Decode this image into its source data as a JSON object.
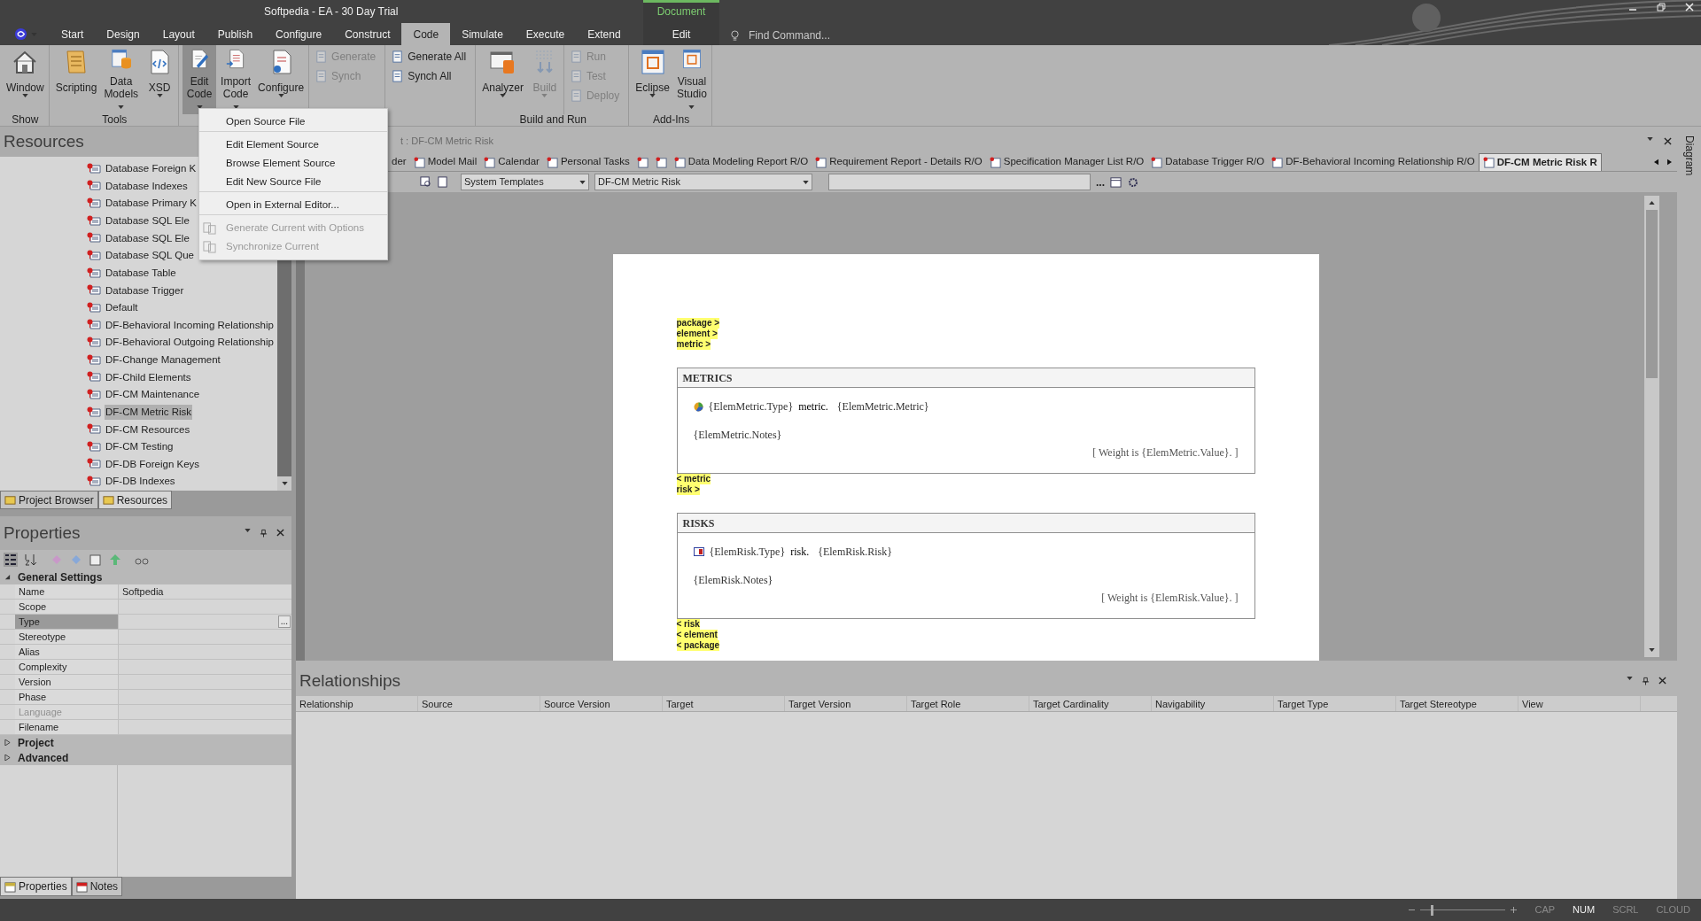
{
  "window": {
    "title": "Softpedia - EA - 30 Day Trial"
  },
  "ribbon_tabs": [
    {
      "label": "Start",
      "selected": false
    },
    {
      "label": "Design",
      "selected": false
    },
    {
      "label": "Layout",
      "selected": false
    },
    {
      "label": "Publish",
      "selected": false
    },
    {
      "label": "Configure",
      "selected": false
    },
    {
      "label": "Construct",
      "selected": false
    },
    {
      "label": "Code",
      "selected": true
    },
    {
      "label": "Simulate",
      "selected": false
    },
    {
      "label": "Execute",
      "selected": false
    },
    {
      "label": "Extend",
      "selected": false
    }
  ],
  "contextual_tab": {
    "group": "Document",
    "label": "Edit"
  },
  "find_command": {
    "placeholder": "Find Command..."
  },
  "ribbon_groups": [
    {
      "label": "Show",
      "items": [
        {
          "kind": "large",
          "label": "Window",
          "dropdown": true,
          "pressed": false,
          "disabled": false
        }
      ]
    },
    {
      "label": "Tools",
      "items": [
        {
          "kind": "large",
          "label": "Scripting",
          "dropdown": false,
          "pressed": false,
          "disabled": false
        },
        {
          "kind": "large",
          "label": "Data Models",
          "dropdown": true,
          "pressed": false,
          "disabled": false
        },
        {
          "kind": "large",
          "label": "XSD",
          "dropdown": true,
          "pressed": false,
          "disabled": false
        }
      ]
    },
    {
      "items": [
        {
          "kind": "large",
          "label": "Edit Code",
          "dropdown": true,
          "pressed": true,
          "disabled": false
        },
        {
          "kind": "large",
          "label": "Import Code",
          "dropdown": true,
          "pressed": false,
          "disabled": false
        },
        {
          "kind": "large",
          "label": "Configure",
          "dropdown": true,
          "pressed": false,
          "disabled": false
        },
        {
          "kind": "stack",
          "items": [
            {
              "label": "Generate",
              "disabled": true
            },
            {
              "label": "Synch",
              "disabled": true
            }
          ]
        },
        {
          "kind": "stack",
          "items": [
            {
              "label": "Generate All",
              "disabled": false
            },
            {
              "label": "Synch All",
              "disabled": false
            }
          ]
        }
      ]
    },
    {
      "label": "Build and Run",
      "items": [
        {
          "kind": "large",
          "label": "Analyzer",
          "dropdown": true,
          "pressed": false,
          "disabled": false
        },
        {
          "kind": "large",
          "label": "Build",
          "dropdown": true,
          "pressed": false,
          "disabled": true
        },
        {
          "kind": "stack",
          "items": [
            {
              "label": "Run",
              "disabled": true
            },
            {
              "label": "Test",
              "disabled": true
            },
            {
              "label": "Deploy",
              "disabled": true
            }
          ]
        }
      ]
    },
    {
      "label": "Add-Ins",
      "items": [
        {
          "kind": "large",
          "label": "Eclipse",
          "dropdown": true,
          "pressed": false,
          "disabled": false
        },
        {
          "kind": "large",
          "label": "Visual Studio",
          "dropdown": true,
          "pressed": false,
          "disabled": false
        }
      ]
    }
  ],
  "edit_code_menu": {
    "items": [
      {
        "label": "Open Source File",
        "disabled": false,
        "separator_after": true
      },
      {
        "label": "Edit Element Source",
        "disabled": false,
        "separator_after": false
      },
      {
        "label": "Browse Element Source",
        "disabled": false,
        "separator_after": false
      },
      {
        "label": "Edit New Source File",
        "disabled": false,
        "separator_after": true
      },
      {
        "label": "Open in External Editor...",
        "disabled": false,
        "separator_after": true
      },
      {
        "label": "Generate Current with Options",
        "disabled": true,
        "separator_after": false
      },
      {
        "label": "Synchronize Current",
        "disabled": true,
        "separator_after": false
      }
    ]
  },
  "resources": {
    "title": "Resources",
    "items": [
      {
        "label": "Database Foreign K",
        "selected": false
      },
      {
        "label": "Database Indexes",
        "selected": false
      },
      {
        "label": "Database Primary K",
        "selected": false
      },
      {
        "label": "Database SQL Ele",
        "selected": false
      },
      {
        "label": "Database SQL Ele",
        "selected": false
      },
      {
        "label": "Database SQL Que",
        "selected": false
      },
      {
        "label": "Database Table",
        "selected": false
      },
      {
        "label": "Database Trigger",
        "selected": false
      },
      {
        "label": "Default",
        "selected": false
      },
      {
        "label": "DF-Behavioral Incoming Relationship",
        "selected": false
      },
      {
        "label": "DF-Behavioral Outgoing Relationship",
        "selected": false
      },
      {
        "label": "DF-Change Management",
        "selected": false
      },
      {
        "label": "DF-Child Elements",
        "selected": false
      },
      {
        "label": "DF-CM Maintenance",
        "selected": false
      },
      {
        "label": "DF-CM Metric Risk",
        "selected": true
      },
      {
        "label": "DF-CM Resources",
        "selected": false
      },
      {
        "label": "DF-CM Testing",
        "selected": false
      },
      {
        "label": "DF-DB Foreign Keys",
        "selected": false
      },
      {
        "label": "DF-DB Indexes",
        "selected": false
      }
    ],
    "tabs": [
      {
        "label": "Project Browser",
        "selected": false
      },
      {
        "label": "Resources",
        "selected": true
      }
    ]
  },
  "properties": {
    "title": "Properties",
    "groups": [
      {
        "label": "General Settings",
        "expanded": true,
        "rows": [
          {
            "name": "Name",
            "value": "Softpedia",
            "selected": false,
            "disabled": false
          },
          {
            "name": "Scope",
            "selected": false,
            "disabled": false
          },
          {
            "name": "Type",
            "selected": true,
            "disabled": false
          },
          {
            "name": "Stereotype",
            "selected": false,
            "disabled": false
          },
          {
            "name": "Alias",
            "selected": false,
            "disabled": false
          },
          {
            "name": "Complexity",
            "selected": false,
            "disabled": false
          },
          {
            "name": "Version",
            "selected": false,
            "disabled": false
          },
          {
            "name": "Phase",
            "selected": false,
            "disabled": false
          },
          {
            "name": "Language",
            "selected": false,
            "disabled": true
          },
          {
            "name": "Filename",
            "selected": false,
            "disabled": false
          }
        ]
      },
      {
        "label": "Project",
        "expanded": false
      },
      {
        "label": "Advanced",
        "expanded": false
      }
    ],
    "ellipsis": "...",
    "tabs": [
      {
        "label": "Properties",
        "selected": true
      },
      {
        "label": "Notes",
        "selected": false
      }
    ]
  },
  "document": {
    "title": "t : DF-CM Metric Risk",
    "tabs": [
      {
        "label": "der",
        "selected": false
      },
      {
        "label": "Model Mail",
        "selected": false
      },
      {
        "label": "Calendar",
        "selected": false
      },
      {
        "label": "Personal Tasks",
        "selected": false
      },
      {
        "selected": false
      },
      {
        "selected": false
      },
      {
        "label": "Data Modeling Report R/O",
        "selected": false
      },
      {
        "label": "Requirement Report - Details R/O",
        "selected": false
      },
      {
        "label": "Specification Manager List R/O",
        "selected": false
      },
      {
        "label": "Database Trigger R/O",
        "selected": false
      },
      {
        "label": "DF-Behavioral Incoming Relationship R/O",
        "selected": false
      },
      {
        "label": "DF-CM Metric Risk R",
        "selected": true
      }
    ],
    "template_set": "System Templates",
    "template": "DF-CM Metric Risk",
    "ellipsis": "...",
    "tags_before": [
      "package >",
      "element >",
      "metric >"
    ],
    "sections": [
      {
        "heading": "METRICS",
        "type_field": "{ElemMetric.Type}",
        "keyword": "metric.",
        "name_field": "{ElemMetric.Metric}",
        "notes": "{ElemMetric.Notes}",
        "weight": "[ Weight is {ElemMetric.Value}. ]",
        "tags_after": [
          "< metric",
          "risk >"
        ]
      },
      {
        "heading": "RISKS",
        "type_field": "{ElemRisk.Type}",
        "keyword": "risk.",
        "name_field": "{ElemRisk.Risk}",
        "notes": "{ElemRisk.Notes}",
        "weight": "[ Weight is {ElemRisk.Value}. ]",
        "tags_after": [
          "< risk",
          "< element",
          "< package"
        ]
      }
    ]
  },
  "relationships": {
    "title": "Relationships",
    "columns": [
      "Relationship",
      "Source",
      "Source Version",
      "Target",
      "Target Version",
      "Target Role",
      "Target Cardinality",
      "Navigability",
      "Target Type",
      "Target Stereotype",
      "View"
    ]
  },
  "side_tab": {
    "label": "Diagram"
  },
  "status_bar": {
    "zoom": {
      "level": 0.12
    },
    "indicators": [
      {
        "label": "CAP",
        "on": false
      },
      {
        "label": "NUM",
        "on": true
      },
      {
        "label": "SCRL",
        "on": false
      },
      {
        "label": "CLOUD",
        "on": false
      }
    ]
  }
}
